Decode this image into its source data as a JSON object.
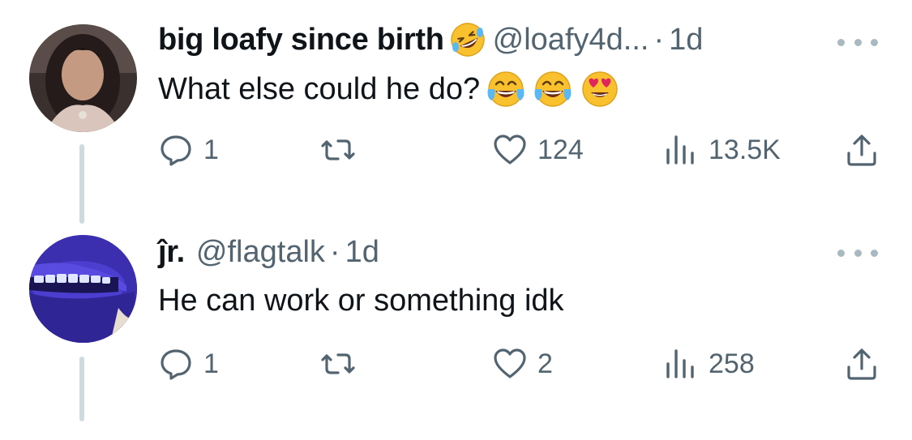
{
  "tweets": [
    {
      "display_name": "big loafy since birth",
      "name_emoji": "rolling-on-floor-laughing",
      "handle": "@loafy4d...",
      "separator": "·",
      "time": "1d",
      "text": "What else could he do?",
      "text_emojis": [
        "face-with-tears-of-joy",
        "face-with-tears-of-joy",
        "smiling-face-with-heart-eyes"
      ],
      "stats": {
        "replies": "1",
        "likes": "124",
        "views": "13.5K"
      }
    },
    {
      "display_name": "ĵr.",
      "handle": "@flagtalk",
      "separator": "·",
      "time": "1d",
      "text": "He can work or something idk",
      "stats": {
        "replies": "1",
        "likes": "2",
        "views": "258"
      }
    }
  ],
  "colors": {
    "text": "#0f1419",
    "secondary": "#536471",
    "thread_line": "#cfd9de",
    "emoji_yellow": "#f9c12e",
    "heart_red": "#e0245e"
  }
}
